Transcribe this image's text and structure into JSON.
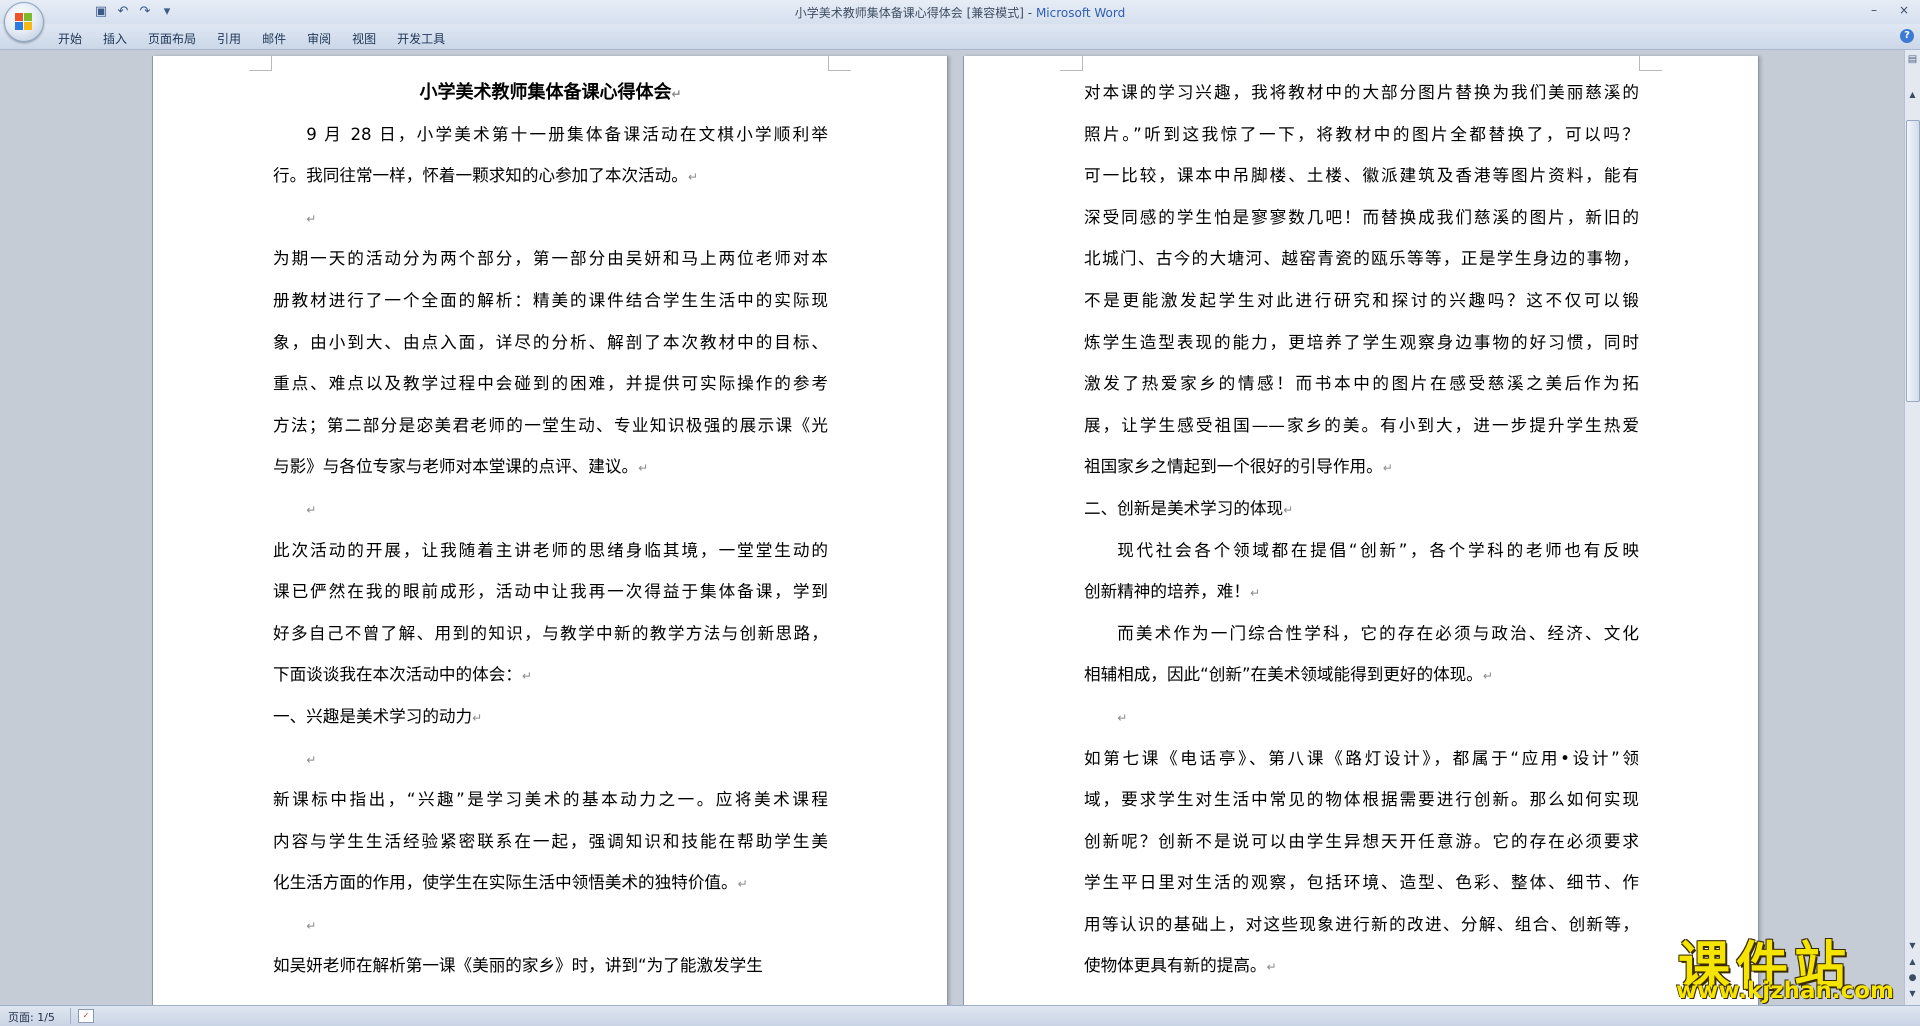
{
  "window": {
    "title": "小学美术教师集体备课心得体会 [兼容模式]",
    "title_sep": " - ",
    "app_name": "Microsoft Word",
    "minimize": "–",
    "close": "×"
  },
  "quick_access": {
    "save_icon": "▣",
    "undo_icon": "↶",
    "redo_icon": "↷",
    "customize_icon": "▾"
  },
  "ribbon": {
    "tabs": [
      "开始",
      "插入",
      "页面布局",
      "引用",
      "邮件",
      "审阅",
      "视图",
      "开发工具"
    ],
    "help_label": "?"
  },
  "document": {
    "page1_lines": [
      {
        "text": "小学美术教师集体备课心得体会",
        "style": "title"
      },
      {
        "text": "9 月 28 日，小学美术第十一册集体备课活动在文棋小学顺利举",
        "style": "indent"
      },
      {
        "text": "行。我同往常一样，怀着一颗求知的心参加了本次活动。",
        "style": "last"
      },
      {
        "text": "",
        "style": "empty"
      },
      {
        "text": "为期一天的活动分为两个部分，第一部分由吴妍和马上两位老师对本",
        "style": "normal"
      },
      {
        "text": "册教材进行了一个全面的解析：精美的课件结合学生生活中的实际现",
        "style": "normal"
      },
      {
        "text": "象，由小到大、由点入面，详尽的分析、解剖了本次教材中的目标、",
        "style": "normal"
      },
      {
        "text": "重点、难点以及教学过程中会碰到的困难，并提供可实际操作的参考",
        "style": "normal"
      },
      {
        "text": "方法；第二部分是宓美君老师的一堂生动、专业知识极强的展示课《光",
        "style": "normal"
      },
      {
        "text": "与影》与各位专家与老师对本堂课的点评、建议。",
        "style": "last"
      },
      {
        "text": "",
        "style": "empty"
      },
      {
        "text": "此次活动的开展，让我随着主讲老师的思绪身临其境，一堂堂生动的",
        "style": "normal"
      },
      {
        "text": "课已俨然在我的眼前成形，活动中让我再一次得益于集体备课，学到",
        "style": "normal"
      },
      {
        "text": "好多自己不曾了解、用到的知识，与教学中新的教学方法与创新思路，",
        "style": "normal"
      },
      {
        "text": "下面谈谈我在本次活动中的体会：",
        "style": "last"
      },
      {
        "text": "一、兴趣是美术学习的动力",
        "style": "last"
      },
      {
        "text": "",
        "style": "empty"
      },
      {
        "text": "新课标中指出，“兴趣”是学习美术的基本动力之一。应将美术课程",
        "style": "normal"
      },
      {
        "text": "内容与学生生活经验紧密联系在一起，强调知识和技能在帮助学生美",
        "style": "normal"
      },
      {
        "text": "化生活方面的作用，使学生在实际生活中领悟美术的独特价值。",
        "style": "last"
      },
      {
        "text": "",
        "style": "empty"
      },
      {
        "text": "如吴妍老师在解析第一课《美丽的家乡》时，讲到“为了能激发学生",
        "style": "normal-nomark"
      }
    ],
    "page2_lines": [
      {
        "text": "对本课的学习兴趣，我将教材中的大部分图片替换为我们美丽慈溪的",
        "style": "normal"
      },
      {
        "text": "照片。”听到这我惊了一下，将教材中的图片全都替换了，可以吗？",
        "style": "normal"
      },
      {
        "text": "可一比较，课本中吊脚楼、土楼、徽派建筑及香港等图片资料，能有",
        "style": "normal"
      },
      {
        "text": "深受同感的学生怕是寥寥数几吧！而替换成我们慈溪的图片，新旧的",
        "style": "normal"
      },
      {
        "text": "北城门、古今的大塘河、越窑青瓷的瓯乐等等，正是学生身边的事物，",
        "style": "normal"
      },
      {
        "text": "不是更能激发起学生对此进行研究和探讨的兴趣吗？这不仅可以锻",
        "style": "normal"
      },
      {
        "text": "炼学生造型表现的能力，更培养了学生观察身边事物的好习惯，同时",
        "style": "normal"
      },
      {
        "text": "激发了热爱家乡的情感！而书本中的图片在感受慈溪之美后作为拓",
        "style": "normal"
      },
      {
        "text": "展，让学生感受祖国——家乡的美。有小到大，进一步提升学生热爱",
        "style": "normal"
      },
      {
        "text": "祖国家乡之情起到一个很好的引导作用。",
        "style": "last"
      },
      {
        "text": "二、创新是美术学习的体现",
        "style": "last"
      },
      {
        "text": "现代社会各个领域都在提倡“创新”，各个学科的老师也有反映",
        "style": "indent"
      },
      {
        "text": "创新精神的培养，难！",
        "style": "last"
      },
      {
        "text": "而美术作为一门综合性学科，它的存在必须与政治、经济、文化",
        "style": "indent"
      },
      {
        "text": "相辅相成，因此“创新”在美术领域能得到更好的体现。",
        "style": "last"
      },
      {
        "text": "",
        "style": "empty"
      },
      {
        "text": "如第七课《电话亭》、第八课《路灯设计》，都属于“应用•设计”领",
        "style": "normal"
      },
      {
        "text": "域，要求学生对生活中常见的物体根据需要进行创新。那么如何实现",
        "style": "normal"
      },
      {
        "text": "创新呢？创新不是说可以由学生异想天开任意游。它的存在必须要求",
        "style": "normal"
      },
      {
        "text": "学生平日里对生活的观察，包括环境、造型、色彩、整体、细节、作",
        "style": "normal"
      },
      {
        "text": "用等认识的基础上，对这些现象进行新的改进、分解、组合、创新等，",
        "style": "normal"
      },
      {
        "text": "使物体更具有新的提高。",
        "style": "last"
      }
    ],
    "paragraph_mark": "↵"
  },
  "statusbar": {
    "page_info": "页面: 1/5"
  },
  "watermark": {
    "title": "课件站",
    "url": "www.kjzhan.com"
  }
}
